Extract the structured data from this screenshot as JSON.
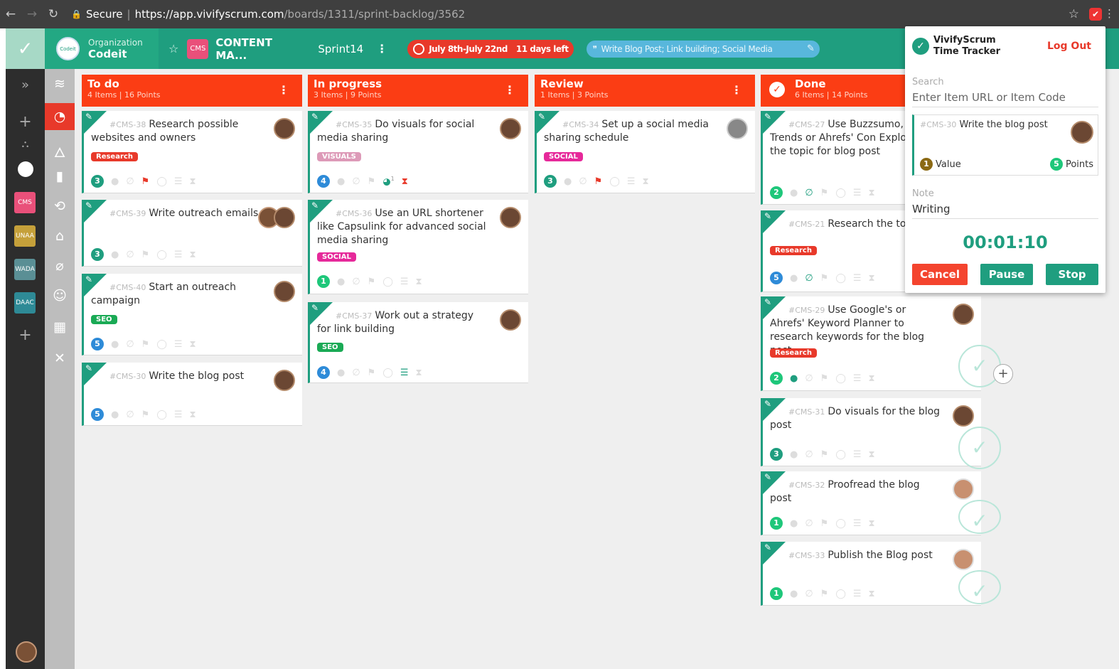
{
  "browser": {
    "secure": "Secure",
    "url_main": "https://app.vivifyscrum.com",
    "url_rest": "/boards/1311/sprint-backlog/3562"
  },
  "header": {
    "org_label": "Organization",
    "org_name": "Codeit",
    "org_logo_text": "Codeit",
    "project_badge": "CMS",
    "project_name": "CONTENT MA...",
    "sprint": "Sprint14",
    "dates": "July 8th-July 22nd",
    "days_left": "11 days left",
    "goal": "Write Blog Post; Link building; Social Media"
  },
  "projects": [
    "CMS",
    "UNAA",
    "WADA",
    "DAAC"
  ],
  "columns": [
    {
      "title": "To do",
      "sub": "4 Items | 16 Points"
    },
    {
      "title": "In progress",
      "sub": "3 Items | 9 Points"
    },
    {
      "title": "Review",
      "sub": "1 Items | 3 Points"
    },
    {
      "title": "Done",
      "sub": "6 Items | 14 Points"
    }
  ],
  "cards": {
    "todo": [
      {
        "code": "#CMS-38",
        "title": "Research possible websites and owners",
        "tag": "Research",
        "points": "3"
      },
      {
        "code": "#CMS-39",
        "title": "Write outreach emails",
        "points": "3"
      },
      {
        "code": "#CMS-40",
        "title": "Start an outreach campaign",
        "tag": "SEO",
        "points": "5"
      },
      {
        "code": "#CMS-30",
        "title": "Write the blog post",
        "points": "5"
      }
    ],
    "progress": [
      {
        "code": "#CMS-35",
        "title": "Do visuals for social media sharing",
        "tag": "VISUALS",
        "points": "4",
        "timer_badge": "1"
      },
      {
        "code": "#CMS-36",
        "title": "Use an URL shortener like Capsulink for advanced social media sharing",
        "tag": "SOCIAL",
        "points": "1"
      },
      {
        "code": "#CMS-37",
        "title": "Work out a strategy for link building",
        "tag": "SEO",
        "points": "4"
      }
    ],
    "review": [
      {
        "code": "#CMS-34",
        "title": "Set up a social media sharing schedule",
        "tag": "SOCIAL",
        "points": "3"
      }
    ],
    "done": [
      {
        "code": "#CMS-27",
        "title": "Use Buzzsumo, Google Trends or Ahrefs' Con Explorer to find the topic for blog post",
        "points": "2"
      },
      {
        "code": "#CMS-21",
        "title": "Research the to",
        "tag": "Research",
        "points": "5"
      },
      {
        "code": "#CMS-29",
        "title": "Use Google's or Ahrefs' Keyword Planner to research keywords for the blog post",
        "tag": "Research",
        "points": "2"
      },
      {
        "code": "#CMS-31",
        "title": "Do visuals for the blog post",
        "points": "3"
      },
      {
        "code": "#CMS-32",
        "title": "Proofread the blog post",
        "points": "1"
      },
      {
        "code": "#CMS-33",
        "title": "Publish the Blog post",
        "points": "1"
      }
    ]
  },
  "tracker": {
    "title1": "VivifyScrum",
    "title2": "Time Tracker",
    "logout": "Log Out",
    "search_label": "Search",
    "search_placeholder": "Enter Item URL or Item Code",
    "item_code": "#CMS-30",
    "item_title": "Write the blog post",
    "value_num": "1",
    "value_label": "Value",
    "points_num": "5",
    "points_label": "Points",
    "note_label": "Note",
    "note_value": "Writing",
    "time": "00:01:10",
    "cancel": "Cancel",
    "pause": "Pause",
    "stop": "Stop"
  },
  "colors": {
    "accent": "#1f9e7f",
    "column_header": "#fb3d14",
    "research": "#e8392a",
    "seo": "#1aaa55",
    "social": "#e6299a",
    "visuals": "#dd9ab8"
  }
}
